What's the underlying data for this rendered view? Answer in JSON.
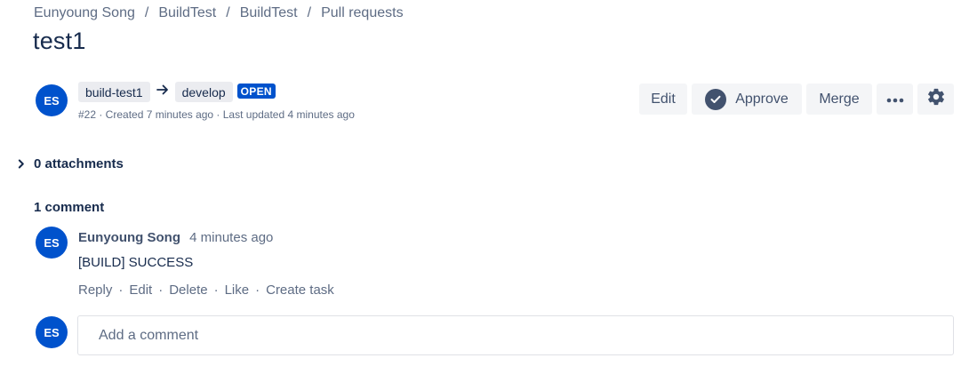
{
  "breadcrumb": {
    "items": [
      "Eunyoung Song",
      "BuildTest",
      "BuildTest",
      "Pull requests"
    ],
    "separator": "/"
  },
  "pr": {
    "title": "test1",
    "author_initials": "ES",
    "source_branch": "build-test1",
    "target_branch": "develop",
    "status": "OPEN",
    "meta": "#22 · Created 7 minutes ago · Last updated 4 minutes ago"
  },
  "actions": {
    "edit": "Edit",
    "approve": "Approve",
    "merge": "Merge",
    "more": "•••"
  },
  "attachments": {
    "label": "0 attachments"
  },
  "comments": {
    "heading": "1 comment",
    "items": [
      {
        "initials": "ES",
        "author": "Eunyoung Song",
        "time": "4 minutes ago",
        "body": "[BUILD] SUCCESS",
        "actions": [
          "Reply",
          "Edit",
          "Delete",
          "Like",
          "Create task"
        ]
      }
    ],
    "new_comment": {
      "initials": "ES",
      "placeholder": "Add a comment"
    }
  },
  "colors": {
    "avatar": "#0052cc",
    "status_badge": "#0052cc",
    "button_bg": "#f4f5f7",
    "text_primary": "#172b4d",
    "text_muted": "#5e6c84"
  },
  "icons": {
    "branch_arrow": "arrow-right-icon",
    "approve": "check-circle-icon",
    "settings": "gear-icon",
    "attachments_toggle": "chevron-right-icon"
  }
}
